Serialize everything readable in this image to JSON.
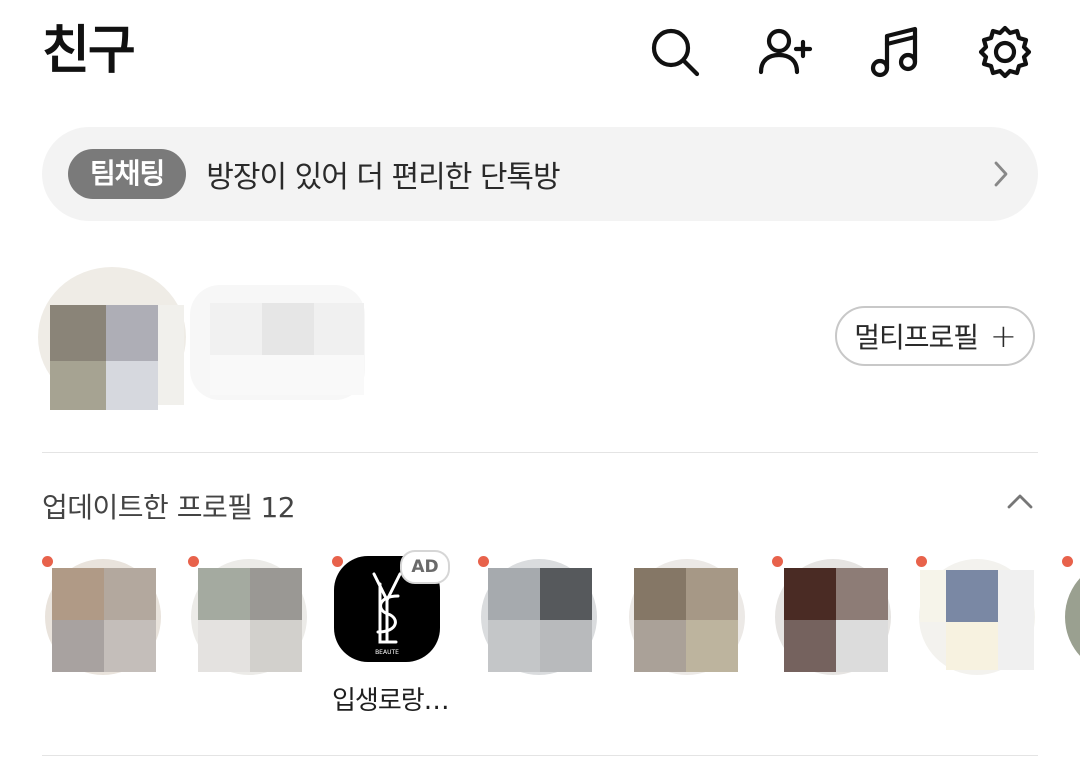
{
  "header": {
    "title": "친구"
  },
  "banner": {
    "pill": "팀채팅",
    "text": "방장이 있어 더 편리한 단톡방"
  },
  "my_profile": {
    "multi_profile_label": "멀티프로필",
    "multi_profile_plus": "+"
  },
  "updated_profiles": {
    "title": "업데이트한 프로필",
    "count": "12",
    "items": [
      {
        "name": ""
      },
      {
        "name": ""
      },
      {
        "name": "입생로랑…",
        "badge": "AD"
      },
      {
        "name": ""
      },
      {
        "name": ""
      },
      {
        "name": ""
      },
      {
        "name": ""
      }
    ]
  },
  "colors": {
    "accent_dot": "#e8624b",
    "pill_bg": "#7a7a7a",
    "banner_bg": "#f3f3f3"
  }
}
